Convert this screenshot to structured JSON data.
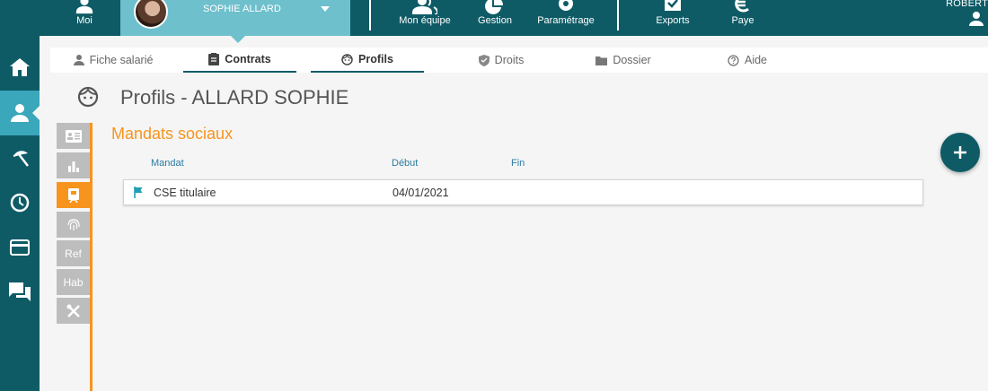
{
  "topbar": {
    "moi": "Moi",
    "employee_name": "SOPHIE ALLARD",
    "mon_equipe": "Mon équipe",
    "gestion": "Gestion",
    "parametrage": "Paramétrage",
    "exports": "Exports",
    "paye": "Paye",
    "user": "ROBERT"
  },
  "tabs": [
    {
      "label": "Fiche salarié",
      "icon": "person-icon"
    },
    {
      "label": "Contrats",
      "icon": "clipboard-icon"
    },
    {
      "label": "Profils",
      "icon": "face-icon"
    },
    {
      "label": "Droits",
      "icon": "shield-icon"
    },
    {
      "label": "Dossier",
      "icon": "folder-icon"
    },
    {
      "label": "Aide",
      "icon": "help-icon"
    }
  ],
  "page": {
    "title": "Profils - ALLARD SOPHIE"
  },
  "subnav": [
    {
      "label": "",
      "icon": "id-card-icon"
    },
    {
      "label": "",
      "icon": "bar-chart-icon"
    },
    {
      "label": "",
      "icon": "badge-icon"
    },
    {
      "label": "",
      "icon": "fingerprint-icon"
    },
    {
      "label": "Ref",
      "icon": ""
    },
    {
      "label": "Hab",
      "icon": ""
    },
    {
      "label": "",
      "icon": "tools-icon"
    }
  ],
  "section": {
    "title": "Mandats sociaux",
    "columns": {
      "mandat": "Mandat",
      "debut": "Début",
      "fin": "Fin"
    },
    "rows": [
      {
        "mandat": "CSE titulaire",
        "debut": "04/01/2021",
        "fin": ""
      }
    ]
  },
  "colors": {
    "primary": "#0e5b66",
    "accent": "#f7941d",
    "active_rail": "#3aa7bb",
    "employee_bg": "#6ec0cd"
  }
}
